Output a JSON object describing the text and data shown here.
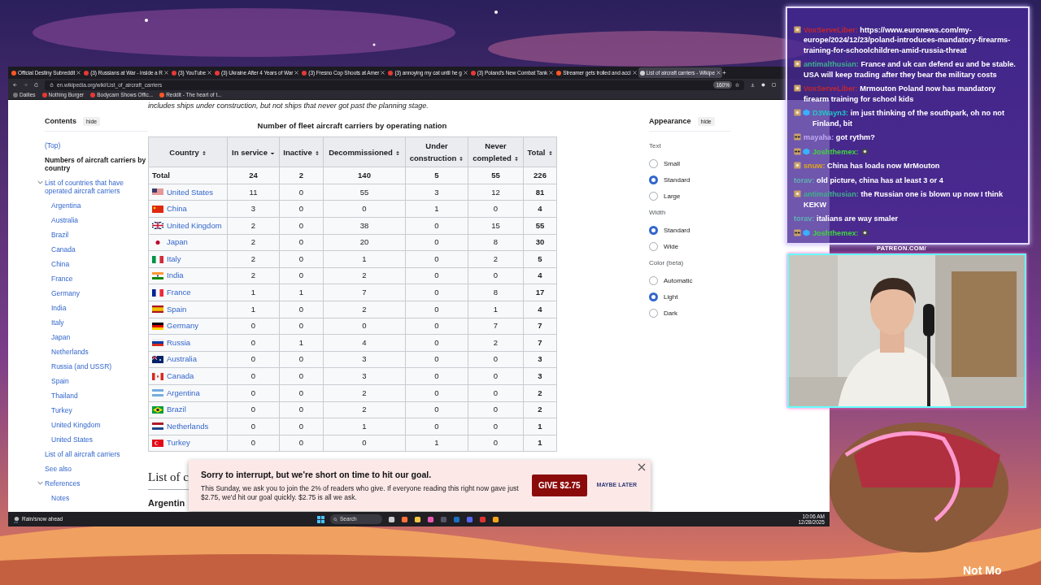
{
  "browser": {
    "tabs": [
      {
        "title": "Official Destiny Subreddit",
        "selected": false
      },
      {
        "title": "(3) Russians at War - inside a R",
        "selected": false
      },
      {
        "title": "(3) YouTube",
        "selected": false
      },
      {
        "title": "(3) Ukraine After 4 Years of War",
        "selected": false
      },
      {
        "title": "(3) Fresno Cop Shoots at Amer",
        "selected": false
      },
      {
        "title": "(3) annoying my cat until he g",
        "selected": false
      },
      {
        "title": "(3) Poland's New Combat Tank",
        "selected": false
      },
      {
        "title": "Streamer gets trolled and acci",
        "selected": false
      },
      {
        "title": "List of aircraft carriers - Wikipe",
        "selected": true
      }
    ],
    "url": "en.wikipedia.org/wiki/List_of_aircraft_carriers",
    "zoom": "160%",
    "bookmarks": [
      "Dailies",
      "Nothing Burger",
      "Bodycam Shows Offic...",
      "Reddit - The heart of t..."
    ]
  },
  "article": {
    "intro_fragment": "includes ships under construction, but not ships that never got past the planning stage.",
    "toc": {
      "title": "Contents",
      "hide": "hide",
      "items": [
        {
          "label": "(Top)",
          "current": false
        },
        {
          "label": "Numbers of aircraft carriers by country",
          "current": true
        },
        {
          "label": "List of countries that have operated aircraft carriers",
          "current": false,
          "expanded": true,
          "children": [
            {
              "label": "Argentina"
            },
            {
              "label": "Australia"
            },
            {
              "label": "Brazil"
            },
            {
              "label": "Canada"
            },
            {
              "label": "China"
            },
            {
              "label": "France"
            },
            {
              "label": "Germany"
            },
            {
              "label": "India"
            },
            {
              "label": "Italy"
            },
            {
              "label": "Japan"
            },
            {
              "label": "Netherlands"
            },
            {
              "label": "Russia (and USSR)"
            },
            {
              "label": "Spain"
            },
            {
              "label": "Thailand"
            },
            {
              "label": "Turkey"
            },
            {
              "label": "United Kingdom"
            },
            {
              "label": "United States"
            }
          ]
        },
        {
          "label": "List of all aircraft carriers",
          "current": false
        },
        {
          "label": "See also",
          "current": false
        },
        {
          "label": "References",
          "current": false,
          "expanded": true,
          "children": [
            {
              "label": "Notes"
            }
          ]
        }
      ]
    },
    "table": {
      "caption": "Number of fleet aircraft carriers by operating nation",
      "columns": [
        {
          "label": "Country",
          "sorted": false
        },
        {
          "label": "In service",
          "sorted": true
        },
        {
          "label": "Inactive",
          "sorted": false
        },
        {
          "label": "Decommissioned",
          "sorted": false
        },
        {
          "label": "Under construction",
          "sorted": false
        },
        {
          "label": "Never completed",
          "sorted": false
        },
        {
          "label": "Total",
          "sorted": false
        }
      ],
      "rows": [
        {
          "kind": "total",
          "cells": [
            "Total",
            "24",
            "2",
            "140",
            "5",
            "55",
            "226"
          ]
        },
        {
          "kind": "country",
          "cells": [
            "United States",
            "11",
            "0",
            "55",
            "3",
            "12",
            "81"
          ]
        },
        {
          "kind": "country",
          "cells": [
            "China",
            "3",
            "0",
            "0",
            "1",
            "0",
            "4"
          ]
        },
        {
          "kind": "country",
          "cells": [
            "United Kingdom",
            "2",
            "0",
            "38",
            "0",
            "15",
            "55"
          ]
        },
        {
          "kind": "country",
          "cells": [
            "Japan",
            "2",
            "0",
            "20",
            "0",
            "8",
            "30"
          ]
        },
        {
          "kind": "country",
          "cells": [
            "Italy",
            "2",
            "0",
            "1",
            "0",
            "2",
            "5"
          ]
        },
        {
          "kind": "country",
          "cells": [
            "India",
            "2",
            "0",
            "2",
            "0",
            "0",
            "4"
          ]
        },
        {
          "kind": "country",
          "cells": [
            "France",
            "1",
            "1",
            "7",
            "0",
            "8",
            "17"
          ]
        },
        {
          "kind": "country",
          "cells": [
            "Spain",
            "1",
            "0",
            "2",
            "0",
            "1",
            "4"
          ]
        },
        {
          "kind": "country",
          "cells": [
            "Germany",
            "0",
            "0",
            "0",
            "0",
            "7",
            "7"
          ]
        },
        {
          "kind": "country",
          "cells": [
            "Russia",
            "0",
            "1",
            "4",
            "0",
            "2",
            "7"
          ]
        },
        {
          "kind": "country",
          "cells": [
            "Australia",
            "0",
            "0",
            "3",
            "0",
            "0",
            "3"
          ]
        },
        {
          "kind": "country",
          "cells": [
            "Canada",
            "0",
            "0",
            "3",
            "0",
            "0",
            "3"
          ]
        },
        {
          "kind": "country",
          "cells": [
            "Argentina",
            "0",
            "0",
            "2",
            "0",
            "0",
            "2"
          ]
        },
        {
          "kind": "country",
          "cells": [
            "Brazil",
            "0",
            "0",
            "2",
            "0",
            "0",
            "2"
          ]
        },
        {
          "kind": "country",
          "cells": [
            "Netherlands",
            "0",
            "0",
            "1",
            "0",
            "0",
            "1"
          ]
        },
        {
          "kind": "country",
          "cells": [
            "Turkey",
            "0",
            "0",
            "0",
            "1",
            "0",
            "1"
          ]
        }
      ]
    },
    "heading": "List of c",
    "subheading": "Argentin"
  },
  "appearance": {
    "title": "Appearance",
    "hide": "hide",
    "groups": [
      {
        "label": "Text",
        "options": [
          {
            "label": "Small",
            "selected": false
          },
          {
            "label": "Standard",
            "selected": true
          },
          {
            "label": "Large",
            "selected": false
          }
        ]
      },
      {
        "label": "Width",
        "options": [
          {
            "label": "Standard",
            "selected": true
          },
          {
            "label": "Wide",
            "selected": false
          }
        ]
      },
      {
        "label": "Color (beta)",
        "options": [
          {
            "label": "Automatic",
            "selected": false
          },
          {
            "label": "Light",
            "selected": true
          },
          {
            "label": "Dark",
            "selected": false
          }
        ]
      }
    ]
  },
  "donation_banner": {
    "title": "Sorry to interrupt, but we're short on time to hit our goal.",
    "body": "This Sunday, we ask you to join the 2% of readers who give. If everyone reading this right now gave just $2.75, we'd hit our goal quickly. $2.75 is all we ask.",
    "give": "GIVE $2.75",
    "later": "MAYBE LATER"
  },
  "taskbar": {
    "weather": "Rain/snow ahead",
    "search": "Search",
    "time": "10:06 AM",
    "date": "12/28/2025"
  },
  "chat": {
    "messages": [
      {
        "user": "VoxServeLiber:",
        "color": "#c0282d",
        "badges": [
          {
            "kind": "generic"
          }
        ],
        "kind": "text",
        "text": "https://www.euronews.com/my-europe/2024/12/23/poland-introduces-mandatory-firearms-training-for-schoolchildren-amid-russia-threat"
      },
      {
        "user": "antimalthusian:",
        "color": "#3fae8c",
        "badges": [
          {
            "kind": "generic"
          }
        ],
        "kind": "text",
        "text": "France and uk can defend eu and be stable. USA will keep trading after they bear the military costs"
      },
      {
        "user": "VoxServeLiber:",
        "color": "#c0282d",
        "badges": [
          {
            "kind": "generic"
          }
        ],
        "kind": "text",
        "text": "Mrmouton Poland now has mandatory firearm training for school kids"
      },
      {
        "user": "D3Wayn3:",
        "color": "#1ec8c8",
        "badges": [
          {
            "kind": "generic"
          },
          {
            "kind": "cube"
          }
        ],
        "kind": "text",
        "text": "im just thinking of the southpark, oh no not Finland, bit"
      },
      {
        "user": "mayaha:",
        "color": "#c0a8f5",
        "badges": [
          {
            "kind": "glasses"
          }
        ],
        "kind": "text",
        "text": "got rythm?"
      },
      {
        "user": "Joshthemex:",
        "color": "#3ed43e",
        "badges": [
          {
            "kind": "glasses"
          },
          {
            "kind": "cube"
          }
        ],
        "kind": "emote"
      },
      {
        "user": "snuw:",
        "color": "#e0a81c",
        "badges": [
          {
            "kind": "generic"
          }
        ],
        "kind": "text",
        "text": "China has loads now MrMouton"
      },
      {
        "user": "torav:",
        "color": "#5fb3b3",
        "kind": "text",
        "text": "old picture, china has at least 3 or 4"
      },
      {
        "user": "antimalthusian:",
        "color": "#3fae8c",
        "badges": [
          {
            "kind": "generic"
          }
        ],
        "kind": "text",
        "text": "the Russian one is blown up now I think KEKW"
      },
      {
        "user": "torav:",
        "color": "#5fb3b3",
        "kind": "text",
        "text": "italians are way smaler"
      },
      {
        "user": "Joshthemex:",
        "color": "#3ed43e",
        "badges": [
          {
            "kind": "glasses"
          },
          {
            "kind": "cube"
          }
        ],
        "kind": "emote"
      }
    ]
  },
  "overlay": {
    "patreon": "PATREON.COM/",
    "caption": "Not Mo"
  }
}
